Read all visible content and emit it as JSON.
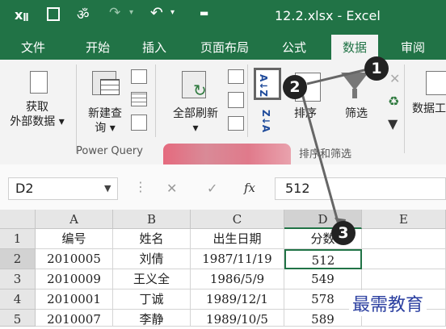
{
  "titlebar": {
    "title": "12.2.xlsx - Excel"
  },
  "tabs": [
    "文件",
    "开始",
    "插入",
    "页面布局",
    "公式",
    "数据",
    "审阅"
  ],
  "ribbon": {
    "get_external_line1": "获取",
    "get_external_line2": "外部数据",
    "new_query_line1": "新建查",
    "new_query_line2": "询",
    "refresh_all": "全部刷新",
    "sort": "排序",
    "filter": "筛选",
    "data_tools_partial": "数据工",
    "group_power_query": "Power Query",
    "group_sort_filter": "排序和筛选",
    "sort_az": "A↓Z",
    "sort_za": "Z↓A"
  },
  "formula_bar": {
    "name_box": "D2",
    "fx": "fx",
    "value": "512"
  },
  "sheet": {
    "columns": [
      "A",
      "B",
      "C",
      "D",
      "E"
    ],
    "rows": [
      {
        "num": "1",
        "cells": [
          "编号",
          "姓名",
          "出生日期",
          "分数",
          ""
        ]
      },
      {
        "num": "2",
        "cells": [
          "2010005",
          "刘倩",
          "1987/11/19",
          "512",
          ""
        ]
      },
      {
        "num": "3",
        "cells": [
          "2010009",
          "王义全",
          "1986/5/9",
          "549",
          ""
        ]
      },
      {
        "num": "4",
        "cells": [
          "2010001",
          "丁诚",
          "1989/12/1",
          "578",
          ""
        ]
      },
      {
        "num": "5",
        "cells": [
          "2010007",
          "李静",
          "1989/10/5",
          "589",
          ""
        ]
      }
    ]
  },
  "annotations": {
    "step1": "1",
    "step2": "2",
    "step3": "3"
  },
  "watermark": "最需教育",
  "colors": {
    "excel_green": "#217346",
    "ribbon_bg": "#f3f3f3",
    "badge": "#222222",
    "watermark": "#2b3fa0"
  }
}
